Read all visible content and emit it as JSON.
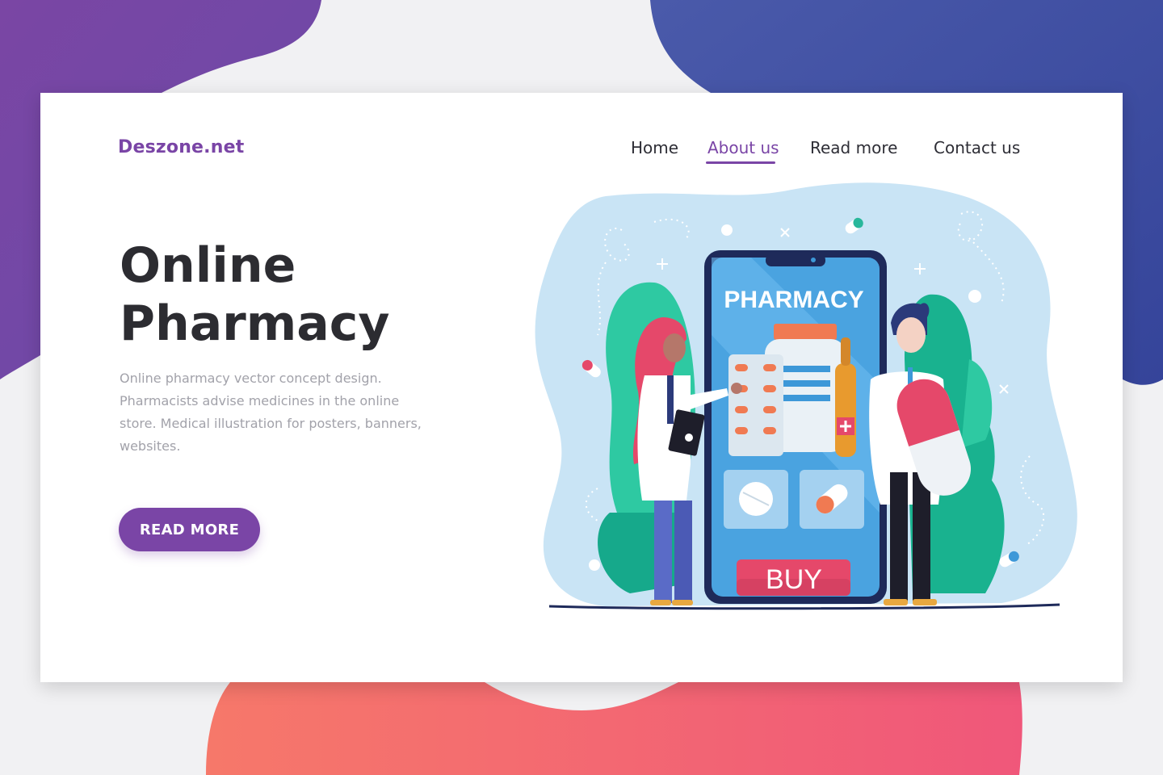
{
  "brand": {
    "logo_text": "Deszone.net"
  },
  "nav": {
    "items": [
      {
        "label": "Home",
        "active": false
      },
      {
        "label": "About us",
        "active": true
      },
      {
        "label": "Read more",
        "active": false
      },
      {
        "label": "Contact us",
        "active": false
      }
    ]
  },
  "hero": {
    "title_line1": "Online",
    "title_line2": "Pharmacy",
    "description": "Online pharmacy vector concept design. Pharmacists advise medicines in the online store. Medical illustration for posters, banners, websites.",
    "cta_label": "READ MORE"
  },
  "illustration": {
    "screen_heading": "PHARMACY",
    "buy_button_label": "BUY"
  },
  "colors": {
    "brand_purple": "#7a45a6",
    "background": "#f1f1f3",
    "blob_purple": "#7a46a4",
    "blob_blue": "#3a4b9e",
    "blob_coral": "#f6726c",
    "buy_red": "#e5486a"
  }
}
